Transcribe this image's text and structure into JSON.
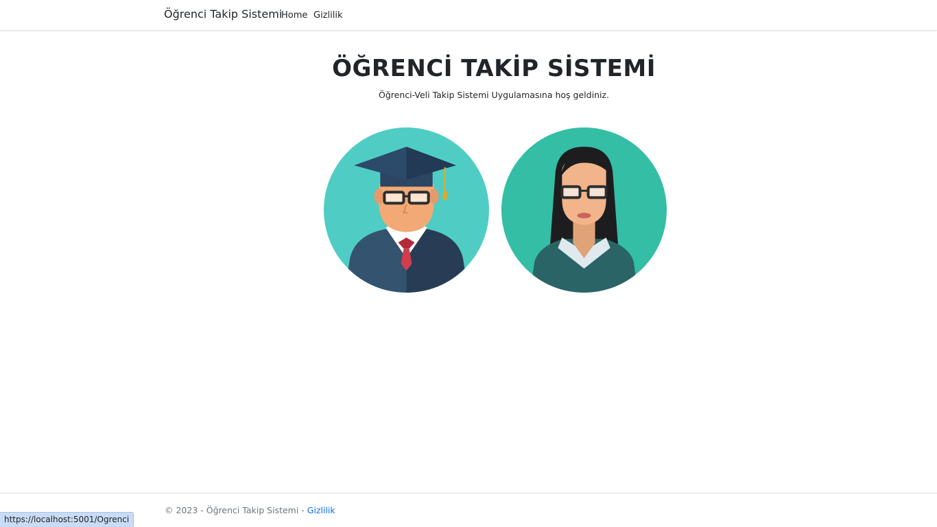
{
  "navbar": {
    "brand": "Öğrenci Takip Sistemi",
    "links": [
      "Home",
      "Gizlilik"
    ]
  },
  "main": {
    "title": "ÖĞRENCİ TAKİP SİSTEMİ",
    "subtitle": "Öğrenci-Veli Takip Sistemi Uygulamasına hoş geldiniz.",
    "avatars": [
      {
        "role": "student",
        "icon": "graduate-avatar-icon",
        "bg_color": "#4fcdc4"
      },
      {
        "role": "parent",
        "icon": "woman-avatar-icon",
        "bg_color": "#33bea5"
      }
    ]
  },
  "footer": {
    "copyright": "© 2023 - Öğrenci Takip Sistemi - ",
    "link": "Gizlilik"
  },
  "status_bar": {
    "url": "https://localhost:5001/Ogrenci"
  },
  "colors": {
    "link": "#0d6efd",
    "border": "#dee2e6"
  }
}
